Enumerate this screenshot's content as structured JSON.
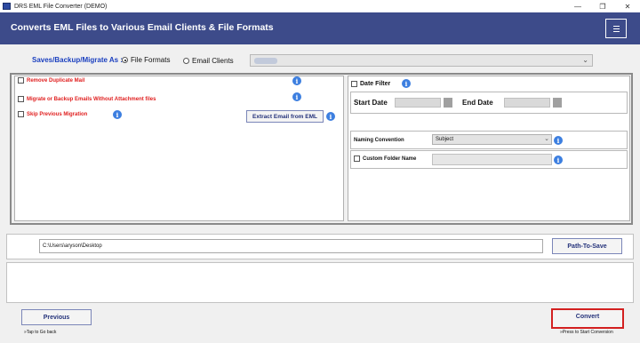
{
  "window": {
    "title": "DRS EML File Converter (DEMO)",
    "minimize": "—",
    "restore": "❐",
    "close": "✕"
  },
  "header": {
    "heading": "Converts EML Files to Various Email Clients & File Formats",
    "menu_icon": "hamburger-menu-icon"
  },
  "save_as": {
    "label": "Saves/Backup/Migrate As :",
    "options": [
      "File Formats",
      "Email Clients"
    ],
    "selected": "File Formats"
  },
  "options_panel": {
    "remove_duplicate": "Remove Duplicate Mail",
    "without_attachment": "Migrate or Backup Emails Without Attachment files",
    "skip_previous": "Skip Previous Migration",
    "extract_email": "Extract Email from EML"
  },
  "filters": {
    "date_filter": "Date Filter",
    "start_date": "Start Date",
    "end_date": "End Date",
    "naming_convention": "Naming Convention",
    "naming_value": "Subject",
    "custom_folder": "Custom Folder Name"
  },
  "path": {
    "value": "C:\\Users\\aryson\\Desktop",
    "button": "Path-To-Save"
  },
  "footer": {
    "previous": "Previous",
    "previous_hint": "»Tap to Go back",
    "convert": "Convert",
    "convert_hint": "»Press to Start Conversion"
  },
  "colors": {
    "banner": "#3d4b8a",
    "accent_blue": "#1a3fbf",
    "warning_red": "#e02020",
    "info_blue": "#3d7fe0",
    "highlight_border": "#d32020"
  },
  "info_glyph": "i"
}
